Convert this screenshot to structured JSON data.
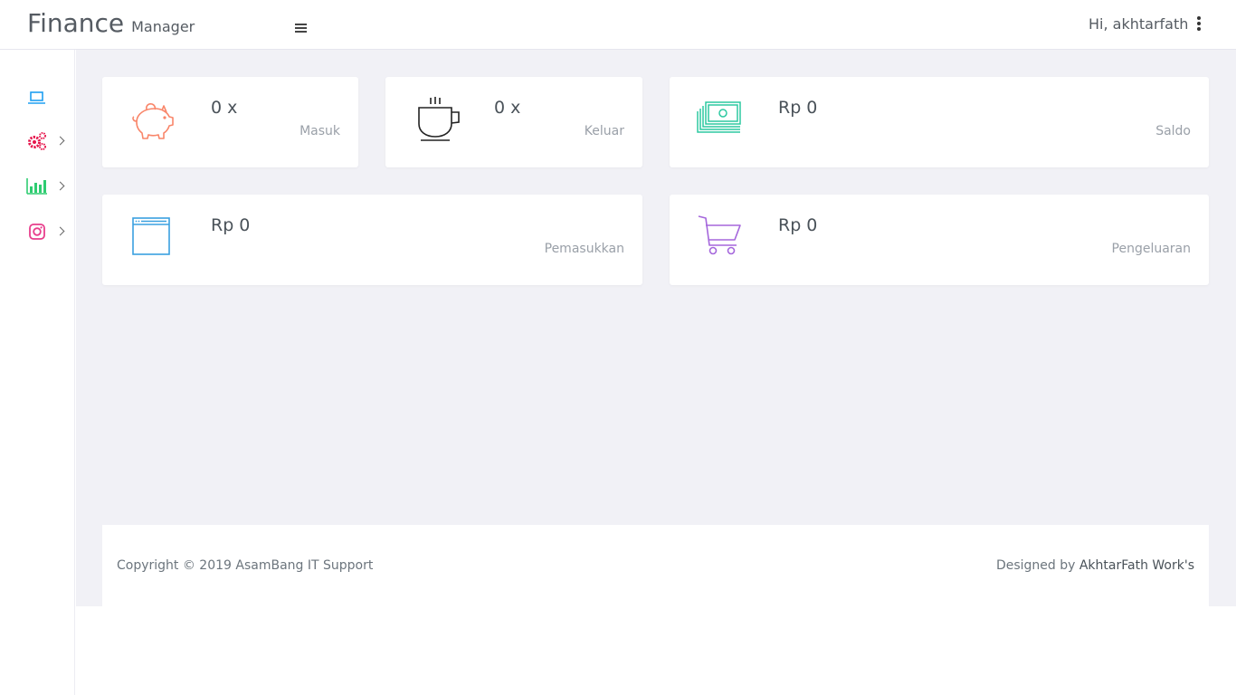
{
  "header": {
    "brand_main": "Finance",
    "brand_sub": "Manager",
    "greeting": "Hi, akhtarfath"
  },
  "sidebar": {
    "items": [
      {
        "icon": "laptop-icon",
        "color": "#1e9ff2",
        "has_chevron": false
      },
      {
        "icon": "gears-icon",
        "color": "#e6144b",
        "has_chevron": true
      },
      {
        "icon": "bar-chart-icon",
        "color": "#2ecc71",
        "has_chevron": true
      },
      {
        "icon": "instagram-icon",
        "color": "#e83e8c",
        "has_chevron": true
      }
    ]
  },
  "cards": [
    {
      "icon": "piggy-bank-icon",
      "color": "#f9866a",
      "value": "0 x",
      "label": "Masuk"
    },
    {
      "icon": "coffee-cup-icon",
      "color": "#222222",
      "value": "0 x",
      "label": "Keluar"
    },
    {
      "icon": "money-stack-icon",
      "color": "#2dc9a1",
      "value": "Rp 0",
      "label": "Saldo"
    },
    {
      "icon": "browser-window-icon",
      "color": "#3aa0e0",
      "value": "Rp 0",
      "label": "Pemasukkan"
    },
    {
      "icon": "shopping-cart-icon",
      "color": "#a567dc",
      "value": "Rp 0",
      "label": "Pengeluaran"
    }
  ],
  "footer": {
    "copyright": "Copyright © 2019 AsamBang IT Support",
    "designed_prefix": "Designed by",
    "designed_link": "AkhtarFath Work's"
  }
}
